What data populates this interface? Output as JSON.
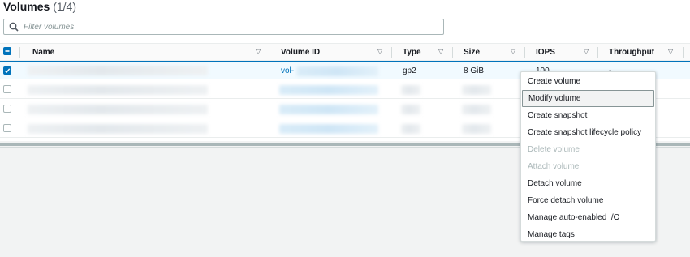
{
  "header": {
    "title": "Volumes",
    "count": "(1/4)"
  },
  "search": {
    "placeholder": "Filter volumes"
  },
  "columns": {
    "name": "Name",
    "volume_id": "Volume ID",
    "type": "Type",
    "size": "Size",
    "iops": "IOPS",
    "throughput": "Throughput"
  },
  "rows": [
    {
      "selected": true,
      "volume_id_prefix": "vol-",
      "type": "gp2",
      "size": "8 GiB",
      "iops": "100",
      "throughput": "-"
    },
    {
      "selected": false
    },
    {
      "selected": false
    },
    {
      "selected": false
    }
  ],
  "menu": {
    "items": [
      {
        "label": "Create volume",
        "enabled": true
      },
      {
        "label": "Modify volume",
        "enabled": true,
        "hovered": true
      },
      {
        "label": "Create snapshot",
        "enabled": true
      },
      {
        "label": "Create snapshot lifecycle policy",
        "enabled": true
      },
      {
        "label": "Delete volume",
        "enabled": false
      },
      {
        "label": "Attach volume",
        "enabled": false
      },
      {
        "label": "Detach volume",
        "enabled": true
      },
      {
        "label": "Force detach volume",
        "enabled": true
      },
      {
        "label": "Manage auto-enabled I/O",
        "enabled": true
      },
      {
        "label": "Manage tags",
        "enabled": true
      }
    ]
  },
  "colors": {
    "accent": "#0073bb",
    "text": "#16191f",
    "disabled": "#aab7b8"
  },
  "icons": {
    "search": "search-icon",
    "sort": "sort-caret-icon"
  }
}
